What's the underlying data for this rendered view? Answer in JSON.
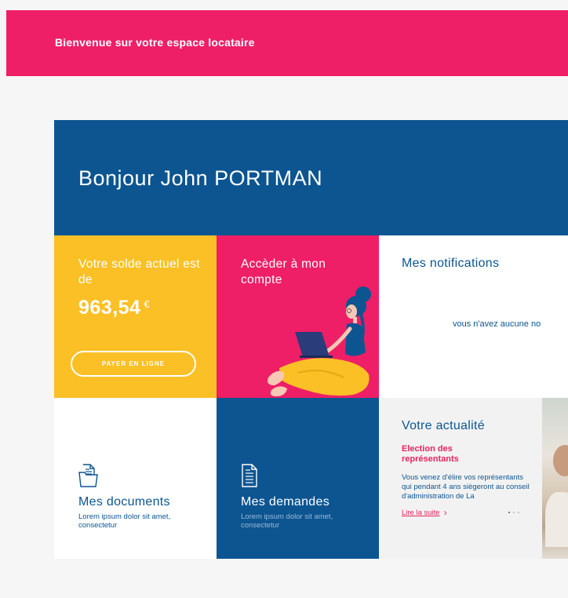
{
  "header": {
    "welcome": "Bienvenue sur votre espace locataire"
  },
  "hero": {
    "greeting": "Bonjour John PORTMAN"
  },
  "balance": {
    "label": "Votre solde actuel est de",
    "amount": "963,54",
    "currency": "€",
    "pay_button": "PAYER EN LIGNE"
  },
  "account": {
    "label": "Accèder à mon compte"
  },
  "notifications": {
    "title": "Mes notifications",
    "empty_text": "vous n'avez aucune no"
  },
  "documents": {
    "title": "Mes documents",
    "subtitle": "Lorem ipsum dolor sit amet, consectetur",
    "icon": "folder-document-icon"
  },
  "requests": {
    "title": "Mes demandes",
    "subtitle": "Lorem ipsum dolor sit amet, consectetur",
    "icon": "document-icon"
  },
  "news": {
    "title": "Votre actualité",
    "headline": "Election des représentants",
    "body": "Vous venez d'élire vos représentants qui pendant 4 ans siègeront au conseil d'administration de La",
    "link": "Lire la suite",
    "slide_count": 3,
    "active_slide": 1
  },
  "colors": {
    "brand_pink": "#ee1f66",
    "brand_blue": "#0c5591",
    "brand_yellow": "#fbc026"
  }
}
